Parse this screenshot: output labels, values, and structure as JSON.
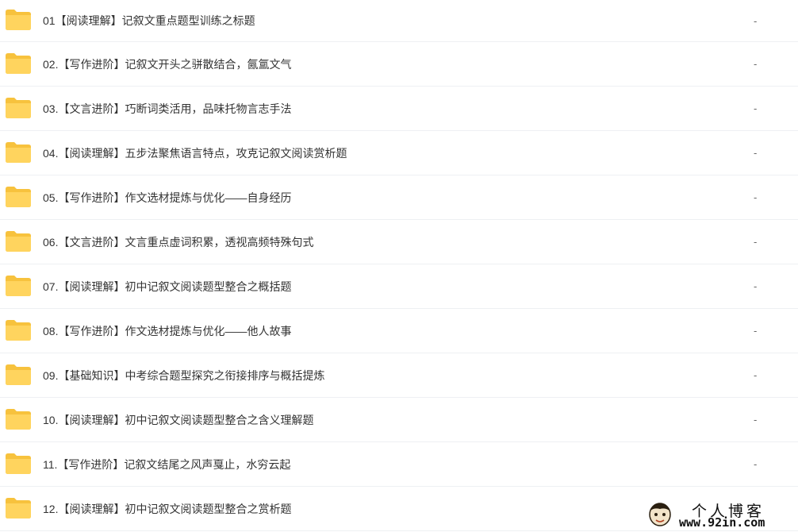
{
  "folder_icon": "folder-icon",
  "colors": {
    "folder_body": "#FFD45E",
    "folder_tab": "#F7C23D",
    "text": "#333333",
    "divider": "#EEF0F3"
  },
  "files": [
    {
      "name": "01【阅读理解】记叙文重点题型训练之标题",
      "size": "-"
    },
    {
      "name": "02.【写作进阶】记叙文开头之骈散结合，氤氲文气",
      "size": "-"
    },
    {
      "name": "03.【文言进阶】巧断词类活用，品味托物言志手法",
      "size": "-"
    },
    {
      "name": "04.【阅读理解】五步法聚焦语言特点，攻克记叙文阅读赏析题",
      "size": "-"
    },
    {
      "name": "05.【写作进阶】作文选材提炼与优化——自身经历",
      "size": "-"
    },
    {
      "name": "06.【文言进阶】文言重点虚词积累，透视高频特殊句式",
      "size": "-"
    },
    {
      "name": "07.【阅读理解】初中记叙文阅读题型整合之概括题",
      "size": "-"
    },
    {
      "name": "08.【写作进阶】作文选材提炼与优化——他人故事",
      "size": "-"
    },
    {
      "name": "09.【基础知识】中考综合题型探究之衔接排序与概括提炼",
      "size": "-"
    },
    {
      "name": "10.【阅读理解】初中记叙文阅读题型整合之含义理解题",
      "size": "-"
    },
    {
      "name": "11.【写作进阶】记叙文结尾之风声戛止，水穷云起",
      "size": "-"
    },
    {
      "name": "12.【阅读理解】初中记叙文阅读题型整合之赏析题",
      "size": "-"
    }
  ],
  "watermark": {
    "title": "个人博客",
    "url": "www.92in.com"
  }
}
